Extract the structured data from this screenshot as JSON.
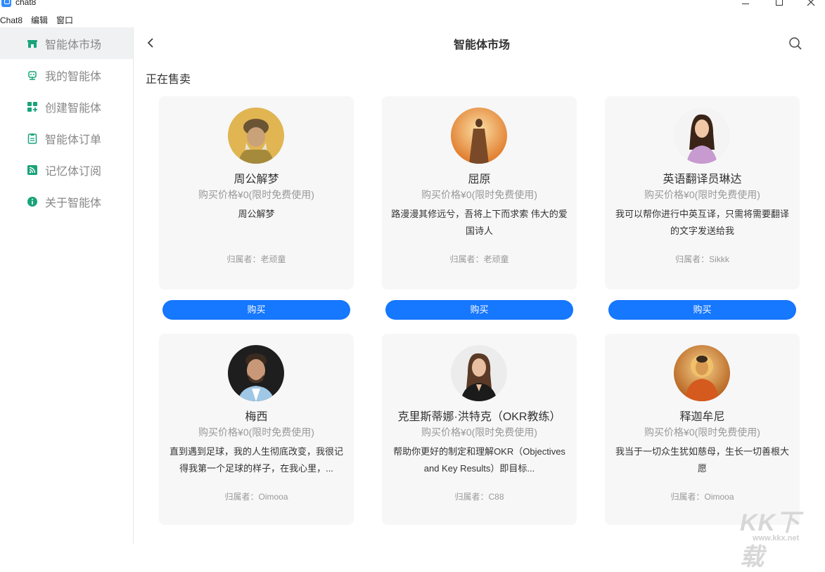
{
  "window": {
    "title": "chat8"
  },
  "menu": [
    "Chat8",
    "编辑",
    "窗口"
  ],
  "sidebar": {
    "items": [
      {
        "label": "智能体市场",
        "icon": "store-icon"
      },
      {
        "label": "我的智能体",
        "icon": "robot-icon"
      },
      {
        "label": "创建智能体",
        "icon": "grid-plus-icon"
      },
      {
        "label": "智能体订单",
        "icon": "clipboard-icon"
      },
      {
        "label": "记忆体订阅",
        "icon": "rss-icon"
      },
      {
        "label": "关于智能体",
        "icon": "info-icon"
      }
    ]
  },
  "header": {
    "title": "智能体市场"
  },
  "section": {
    "title": "正在售卖"
  },
  "agents": [
    {
      "name": "周公解梦",
      "price": "购买价格¥0(限时免费使用)",
      "desc": "周公解梦",
      "owner": "归属者：老顽童",
      "buy": "购买"
    },
    {
      "name": "屈原",
      "price": "购买价格¥0(限时免费使用)",
      "desc": "路漫漫其修远兮，吾将上下而求索 伟大的爱国诗人",
      "owner": "归属者：老顽童",
      "buy": "购买"
    },
    {
      "name": "英语翻译员琳达",
      "price": "购买价格¥0(限时免费使用)",
      "desc": "我可以帮你进行中英互译，只需将需要翻译的文字发送给我",
      "owner": "归属者：Sikkk",
      "buy": "购买"
    },
    {
      "name": "梅西",
      "price": "购买价格¥0(限时免费使用)",
      "desc": "直到遇到足球，我的人生彻底改变，我很记得我第一个足球的样子，在我心里，...",
      "owner": "归属者：Oimooa"
    },
    {
      "name": "克里斯蒂娜·洪特克（OKR教练）",
      "price": "购买价格¥0(限时免费使用)",
      "desc": "帮助你更好的制定和理解OKR（Objectives and Key Results）即目标...",
      "owner": "归属者：C88"
    },
    {
      "name": "释迦牟尼",
      "price": "购买价格¥0(限时免费使用)",
      "desc": "我当于一切众生犹如慈母，生长一切善根大愿",
      "owner": "归属者：Oimooa"
    }
  ],
  "colors": {
    "accent": "#1677ff",
    "sidebar_icon": "#1aa37a"
  },
  "watermark": {
    "text": "KK下载",
    "url": "www.kkx.net"
  }
}
